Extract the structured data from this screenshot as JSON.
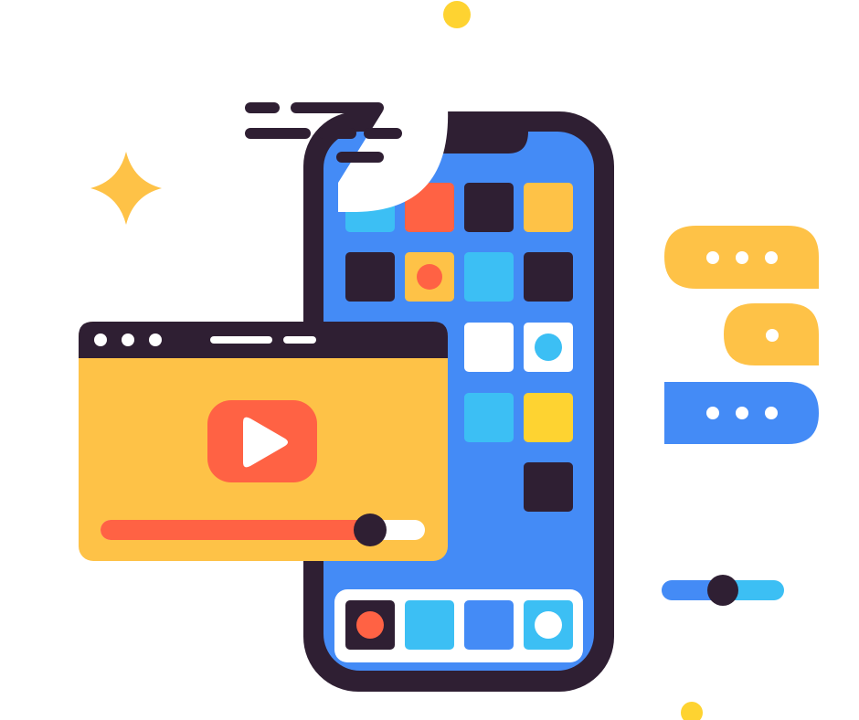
{
  "illustration": {
    "colors": {
      "dark": "#2f1f33",
      "phone_screen": "#448bf6",
      "yellow": "#fec247",
      "bright_yellow": "#fed331",
      "coral": "#ff6244",
      "sky": "#3cbff4",
      "white": "#ffffff",
      "blue_bubble": "#448bf6"
    },
    "video_player": {
      "icon": "play-icon",
      "progress": 0.83,
      "controls": [
        "dot",
        "dot",
        "dot"
      ]
    },
    "chat_bubbles": [
      {
        "color": "yellow",
        "dots": 3
      },
      {
        "color": "yellow",
        "dots": 1
      },
      {
        "color": "blue",
        "dots": 3
      }
    ],
    "slider": {
      "value": 0.5
    },
    "phone_apps": [
      [
        "sky",
        "coral",
        "dark",
        "yellow"
      ],
      [
        "dark",
        "yellow-dot",
        "sky",
        "dark"
      ],
      [
        "",
        "",
        "white",
        "white-dot"
      ],
      [
        "",
        "",
        "sky",
        "bright_yellow"
      ],
      [
        "",
        "",
        "",
        "dark"
      ]
    ],
    "dock_apps": [
      "dark-dot",
      "sky",
      "blue",
      "sky-dot"
    ],
    "decorations": [
      "sparkle-icon",
      "dot",
      "dot",
      "speech-bubble"
    ]
  }
}
